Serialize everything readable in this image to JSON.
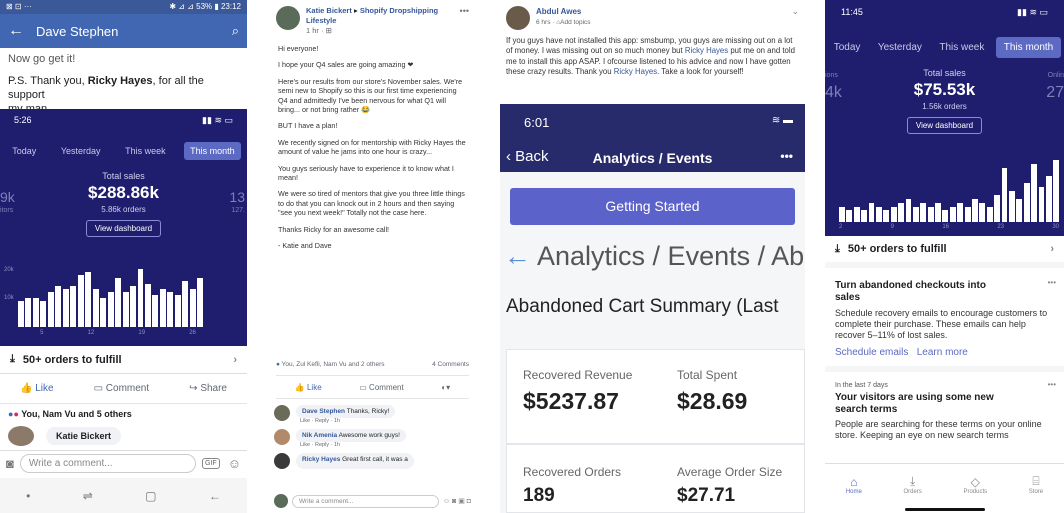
{
  "p1": {
    "status": {
      "left": "⊠ ⊡ ···",
      "right": "✱ ⊿ ⊿ 53% ▮ 23:12"
    },
    "title": "Dave Stephen",
    "post_lines": [
      "Now go get it!",
      "P.S. Thank you, ",
      "Ricky Hayes",
      ", for all the support",
      "my man"
    ],
    "shop": {
      "time": "5:26",
      "tabs": [
        "Today",
        "Yesterday",
        "This week",
        "This month"
      ],
      "left_big": "9k",
      "left_small": "itors",
      "label": "Total sales",
      "value": "$288.86k",
      "orders": "5.86k orders",
      "right_big": "13",
      "right_small": "127.",
      "button": "View dashboard",
      "y_ticks": [
        "20k",
        "10k"
      ],
      "x_ticks": [
        "5",
        "12",
        "19",
        "26"
      ]
    },
    "fulfill": "50+ orders to fulfill",
    "actions": [
      "Like",
      "Comment",
      "Share"
    ],
    "reactions": "You, Nam Vu and 5 others",
    "commenter": "Katie Bickert",
    "input_placeholder": "Write a comment...",
    "gif": "GIF"
  },
  "p2": {
    "author": "Katie Bickert",
    "arrow": "▸",
    "group": "Shopify Dropshipping Lifestyle",
    "time": "1 hr",
    "paras": [
      "Hi everyone!",
      "I hope your Q4 sales are going amazing ❤",
      "Here's our results from our store's November sales. We're semi new to Shopify so this is our first time experiencing Q4 and admittedly I've been nervous for what Q1 will bring... or not bring rather 😂",
      "BUT I have a plan!",
      "We recently signed on for mentorship with Ricky Hayes the amount of value he jams into one hour is crazy...",
      "You guys seriously have to experience it to know what I mean!",
      "We were so tired of mentors that give you three little things to do that you can knock out in 2 hours and then saying \"see you next week!\" Totally not the case here.",
      "Thanks Ricky for an awesome call!",
      "- Katie and Dave"
    ],
    "reactions": "You, Zul Kefli, Nam Vu and 2 others",
    "comments_count": "4 Comments",
    "like": "Like",
    "comment": "Comment",
    "comments": [
      {
        "name": "Dave Stephen",
        "text": "Thanks, Ricky!",
        "meta": "Like · Reply · 1h"
      },
      {
        "name": "Nik Amenia",
        "text": "Awesome work guys!",
        "meta": "Like · Reply · 1h"
      },
      {
        "name": "Ricky Hayes",
        "text": "Great first call, it was a",
        "meta": ""
      }
    ],
    "input_placeholder": "Write a comment..."
  },
  "p3": {
    "author": "Abdul Awes",
    "time": "6 hrs",
    "add_topics": "Add topics",
    "text_a": "If you guys have not installed this app: smsbump, you guys are missing out on a lot of money. I was missing out on so much money but ",
    "text_link": "Ricky Hayes",
    "text_b": " put me on and told me to install this app ASAP. I ofcourse listened to his advice and now I have gotten these crazy results. Thank you ",
    "text_link2": "Ricky Hayes",
    "text_c": ". Take a look for yourself!",
    "phone_time": "6:01",
    "back": "Back",
    "nav_title": "Analytics / Events",
    "more": "•••",
    "btn": "Getting Started",
    "heading": "Analytics / Events / Ab",
    "summary": "Abandoned Cart Summary (Last",
    "metrics": [
      {
        "label": "Recovered Revenue",
        "value": "$5237.87"
      },
      {
        "label": "Total Spent",
        "value": "$28.69"
      },
      {
        "label": "Recovered Orders",
        "value": "189"
      },
      {
        "label": "Average Order Size",
        "value": "$27.71"
      }
    ]
  },
  "p4": {
    "time": "11:45",
    "tabs": [
      "Today",
      "Yesterday",
      "This week",
      "This month"
    ],
    "left_big": "4k",
    "left_small": "ions",
    "label": "Total sales",
    "value": "$75.53k",
    "orders": "1.56k orders",
    "right_big": "27",
    "right_small": "Onlin",
    "button": "View dashboard",
    "x_ticks": [
      "2",
      "9",
      "16",
      "23",
      "30"
    ],
    "fulfill": "50+ orders to fulfill",
    "card1": {
      "title": "Turn abandoned checkouts into sales",
      "body": "Schedule recovery emails to encourage customers to complete their purchase. These emails can help recover 5–11% of lost sales.",
      "link1": "Schedule emails",
      "link2": "Learn more"
    },
    "card2": {
      "small": "In the last 7 days",
      "title": "Your visitors are using some new search terms",
      "body": "People are searching for these terms on your online store. Keeping an eye on new search terms"
    },
    "nav": [
      "Home",
      "Orders",
      "Products",
      "Store"
    ]
  },
  "chart_p1": {
    "type": "bar",
    "values": [
      9,
      10,
      10,
      9,
      12,
      14,
      13,
      14,
      18,
      19,
      13,
      10,
      12,
      17,
      12,
      14,
      20,
      15,
      11,
      13,
      12,
      11,
      16,
      13,
      17,
      0,
      0
    ]
  },
  "chart_p4": {
    "type": "bar",
    "values": [
      4,
      3,
      4,
      3,
      5,
      4,
      3,
      4,
      5,
      6,
      4,
      5,
      4,
      5,
      3,
      4,
      5,
      4,
      6,
      5,
      4,
      7,
      14,
      8,
      6,
      10,
      15,
      9,
      12,
      16
    ]
  }
}
